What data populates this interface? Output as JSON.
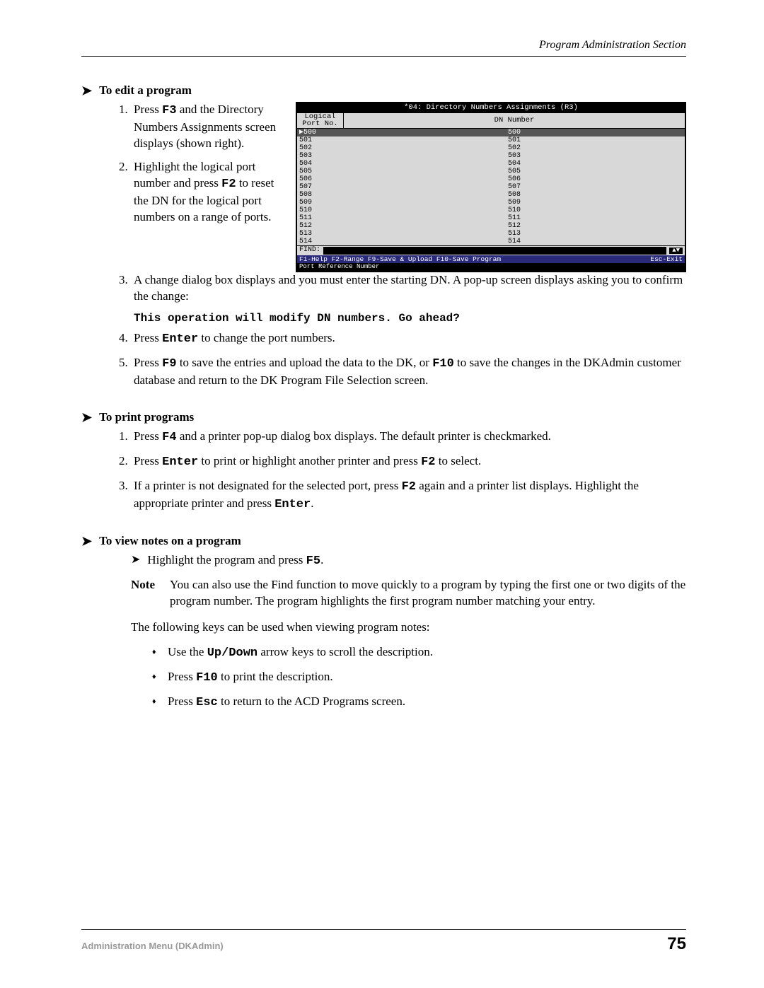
{
  "header": {
    "section": "Program Administration Section"
  },
  "headings": {
    "edit": "To edit a program",
    "print": "To print programs",
    "view": "To view notes on a program"
  },
  "edit_steps": {
    "s1a": "Press ",
    "s1_key": "F3",
    "s1b": " and the Directory Numbers Assignments screen displays (shown right).",
    "s2a": "Highlight the logical port number and press ",
    "s2_key": "F2",
    "s2b": " to reset the DN for the logical port numbers on a range of ports.",
    "s3": "A change dialog box displays and you must enter the starting DN. A pop-up screen displays asking you to confirm the change:",
    "confirm": "This operation will modify DN numbers. Go ahead?",
    "s4a": "Press ",
    "s4_key": "Enter",
    "s4b": " to change the port numbers.",
    "s5a": "Press ",
    "s5_key1": "F9",
    "s5b": " to save the entries and upload the data to the DK, or ",
    "s5_key2": "F10",
    "s5c": " to save the changes in the DKAdmin customer database and return to the DK Program File Selection screen."
  },
  "print_steps": {
    "s1a": "Press ",
    "s1_key": "F4",
    "s1b": " and a printer pop-up dialog box displays. The default printer is checkmarked.",
    "s2a": "Press ",
    "s2_key1": "Enter",
    "s2b": " to print or highlight another printer and press ",
    "s2_key2": "F2",
    "s2c": " to select.",
    "s3a": "If a printer is not designated for the selected port, press ",
    "s3_key1": "F2",
    "s3b": " again and a printer list displays. Highlight the appropriate printer and press ",
    "s3_key2": "Enter",
    "s3c": "."
  },
  "view_section": {
    "sub_a": "Highlight the program and press ",
    "sub_key": "F5",
    "sub_b": ".",
    "note_label": "Note",
    "note_text": "You can also use the Find function to move quickly to a program by typing the first one or two digits of the program number. The program highlights the first program number matching your entry.",
    "intro": "The following keys can be used when viewing program notes:",
    "b1a": "Use the ",
    "b1_key": "Up/Down",
    "b1b": " arrow keys to scroll the description.",
    "b2a": "Press ",
    "b2_key": "F10",
    "b2b": " to print the description.",
    "b3a": "Press ",
    "b3_key": "Esc",
    "b3b": " to return to the ACD Programs screen."
  },
  "screenshot": {
    "title": "*04: Directory Numbers Assignments (R3)",
    "col1a": "Logical",
    "col1b": "Port No.",
    "col2": "DN Number",
    "rows": [
      {
        "port": "500",
        "dn": "500",
        "sel": true
      },
      {
        "port": "501",
        "dn": "501"
      },
      {
        "port": "502",
        "dn": "502"
      },
      {
        "port": "503",
        "dn": "503"
      },
      {
        "port": "504",
        "dn": "504"
      },
      {
        "port": "505",
        "dn": "505"
      },
      {
        "port": "506",
        "dn": "506"
      },
      {
        "port": "507",
        "dn": "507"
      },
      {
        "port": "508",
        "dn": "508"
      },
      {
        "port": "509",
        "dn": "509"
      },
      {
        "port": "510",
        "dn": "510"
      },
      {
        "port": "511",
        "dn": "511"
      },
      {
        "port": "512",
        "dn": "512"
      },
      {
        "port": "513",
        "dn": "513"
      },
      {
        "port": "514",
        "dn": "514"
      }
    ],
    "find": "FIND:",
    "scroll": "▲▼",
    "foot_left": "F1-Help  F2-Range  F9-Save & Upload  F10-Save Program",
    "foot_right": "Esc-Exit",
    "subfoot": "Port Reference Number"
  },
  "footer": {
    "left": "Administration Menu (DKAdmin)",
    "page": "75"
  }
}
